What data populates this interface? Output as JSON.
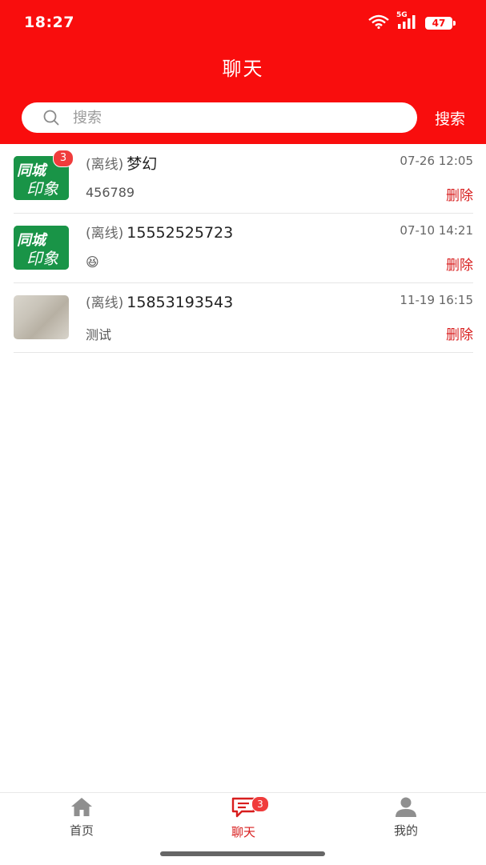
{
  "status_bar": {
    "time": "18:27",
    "network": "5G",
    "battery": "47"
  },
  "header": {
    "title": "聊天"
  },
  "search": {
    "placeholder": "搜索",
    "button_label": "搜索"
  },
  "chats": [
    {
      "status": "(离线)",
      "name": "梦幻",
      "time": "07-26 12:05",
      "preview": "456789",
      "delete_label": "删除",
      "avatar_text_1": "同城",
      "avatar_text_2": "印象",
      "unread": "3"
    },
    {
      "status": "(离线)",
      "name": "15552525723",
      "time": "07-10 14:21",
      "preview": "😆",
      "delete_label": "删除",
      "avatar_text_1": "同城",
      "avatar_text_2": "印象"
    },
    {
      "status": "(离线)",
      "name": "15853193543",
      "time": "11-19 16:15",
      "preview": "测试",
      "delete_label": "删除"
    }
  ],
  "tabbar": {
    "home_label": "首页",
    "chat_label": "聊天",
    "chat_badge": "3",
    "mine_label": "我的"
  },
  "colors": {
    "brand_red": "#f90d0d",
    "delete_red": "#d81e1e",
    "avatar_green": "#199447"
  }
}
